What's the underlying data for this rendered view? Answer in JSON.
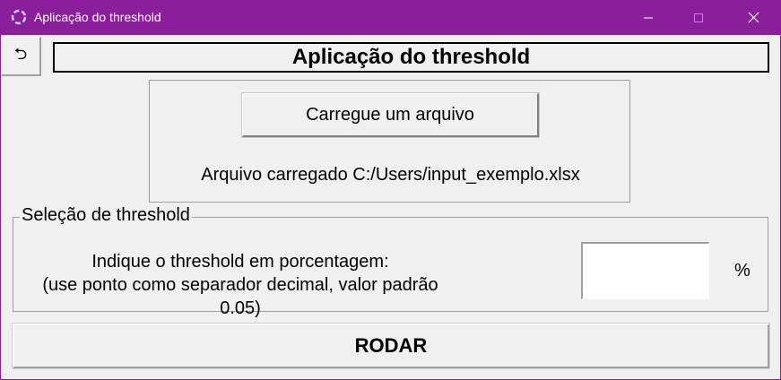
{
  "window": {
    "title": "Aplicação do threshold",
    "controls": {
      "minimize_icon": "minimize-icon",
      "maximize_icon": "maximize-icon",
      "close_icon": "close-icon"
    }
  },
  "header": {
    "back_symbol": "⮌",
    "title": "Aplicação do threshold"
  },
  "file_section": {
    "load_button": "Carregue um arquivo",
    "loaded_label": "Arquivo carregado C:/Users/input_exemplo.xlsx"
  },
  "threshold_section": {
    "group_title": "Seleção de threshold",
    "instruction_line1": "Indique o threshold em porcentagem:",
    "instruction_line2": "(use ponto como separador decimal, valor padrão 0.05)",
    "input_value": "",
    "unit": "%"
  },
  "run_button": "RODAR",
  "colors": {
    "titlebar": "#8b1e9b",
    "client": "#f0f0f0"
  }
}
